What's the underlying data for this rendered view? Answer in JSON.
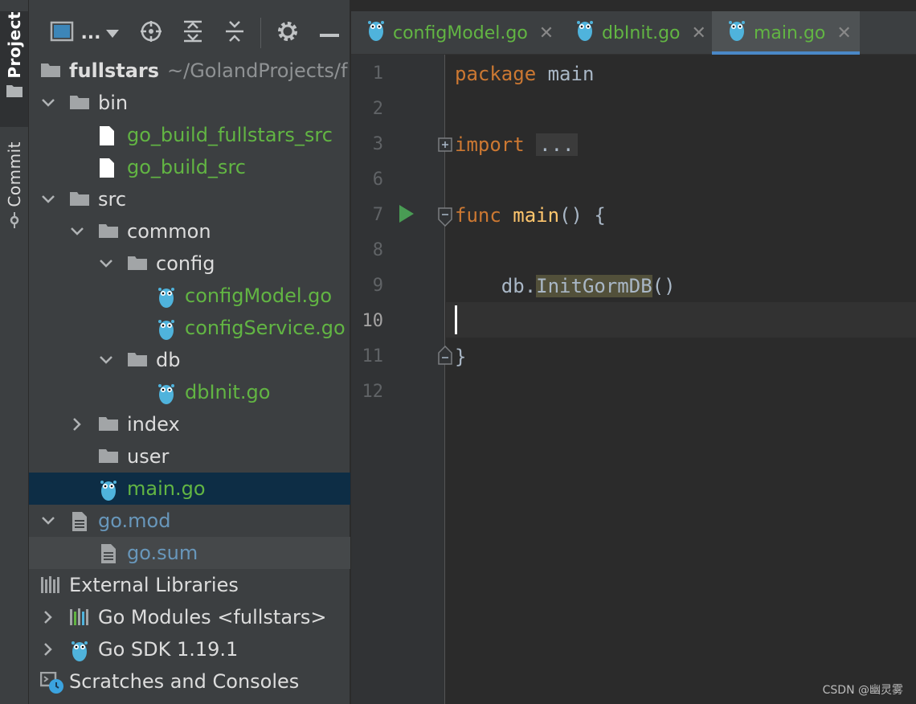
{
  "strip": {
    "project_label": "Project",
    "commit_label": "Commit"
  },
  "toolbar": {
    "view_mode_label": "...",
    "icons": [
      "panel-icon",
      "locate-icon",
      "expand-all-icon",
      "collapse-all-icon",
      "gear-icon",
      "minimize-icon"
    ]
  },
  "tree": {
    "root": {
      "name": "fullstars",
      "path": "~/GolandProjects/f"
    },
    "bin": "bin",
    "bin_file1": "go_build_fullstars_src",
    "bin_file2": "go_build_src",
    "src": "src",
    "common": "common",
    "config": "config",
    "config_model": "configModel.go",
    "config_service": "configService.go",
    "db": "db",
    "db_init": "dbInit.go",
    "index": "index",
    "user": "user",
    "main": "main.go",
    "gomod": "go.mod",
    "gosum": "go.sum",
    "external": "External Libraries",
    "gomodules": "Go Modules <fullstars>",
    "gosdk": "Go SDK 1.19.1",
    "scratches": "Scratches and Consoles"
  },
  "tabs": [
    {
      "name": "configModel.go",
      "active": false
    },
    {
      "name": "dbInit.go",
      "active": false
    },
    {
      "name": "main.go",
      "active": true
    }
  ],
  "editor": {
    "line_numbers": [
      "1",
      "2",
      "3",
      "6",
      "7",
      "8",
      "9",
      "10",
      "11",
      "12"
    ],
    "current_line": "10",
    "code": {
      "l1_kw": "package",
      "l1_name": " main",
      "l3_kw": "import",
      "l3_fold": "...",
      "l7_kw": "func",
      "l7_fn": " main",
      "l7_rest": "() {",
      "l9_pkg": "    db.",
      "l9_call": "InitGormDB",
      "l9_rest": "()",
      "l11": "}"
    }
  },
  "watermark": "CSDN @幽灵雾",
  "colors": {
    "go_green": "#62b543",
    "keyword_orange": "#cc7832",
    "function_yellow": "#ffc66d",
    "selection": "#0d2d45",
    "tab_underline": "#4a88c7",
    "run_green": "#499c54"
  }
}
